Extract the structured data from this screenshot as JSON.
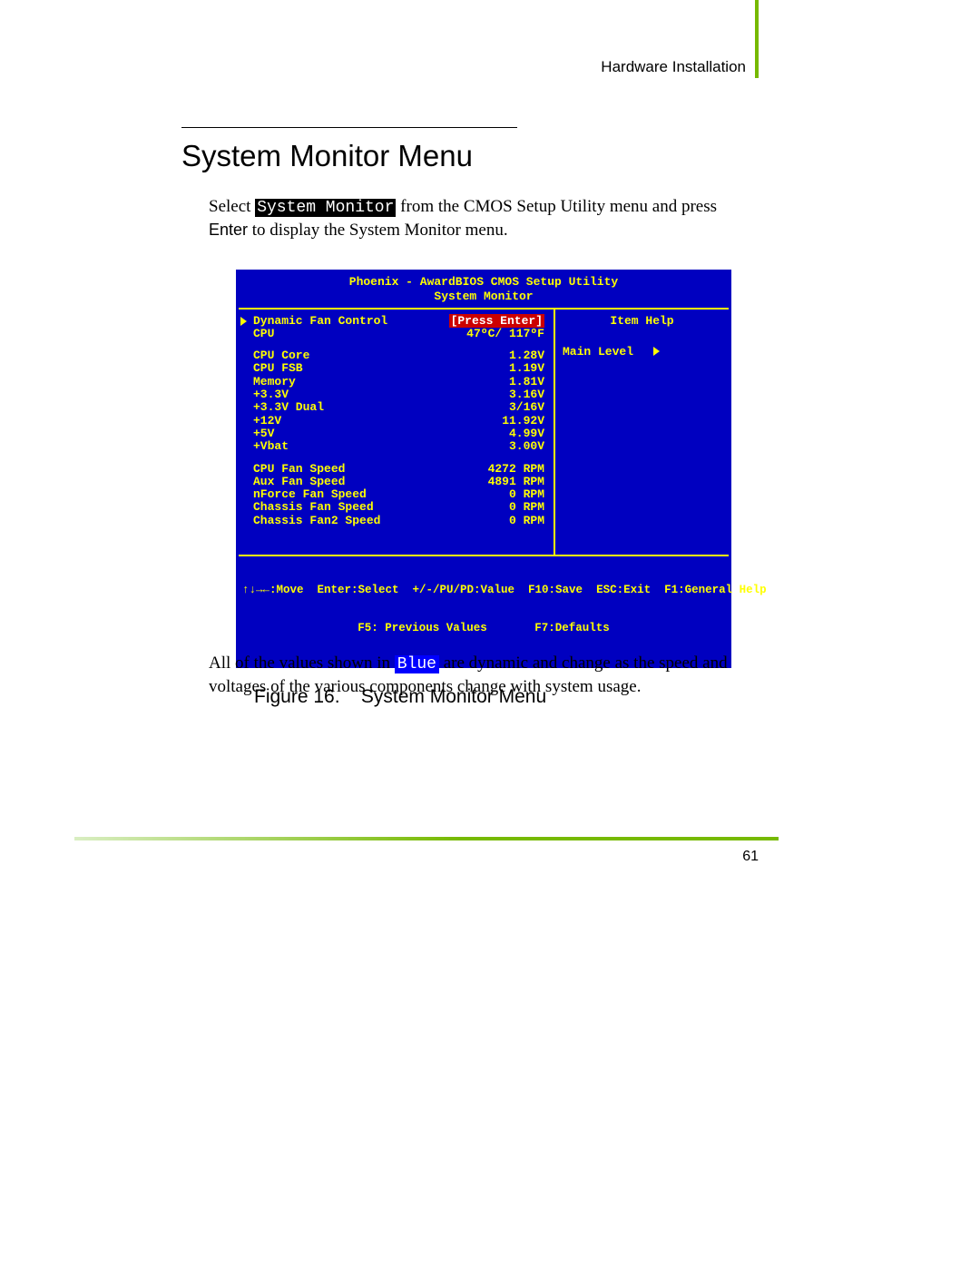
{
  "header": {
    "breadcrumb": "Hardware Installation"
  },
  "title": "System Monitor Menu",
  "intro": {
    "pre": "Select ",
    "box": "System Monitor",
    "mid": " from the CMOS Setup Utility menu and press ",
    "kbd": "Enter",
    "post": " to display the System Monitor menu."
  },
  "bios": {
    "title_line1": "Phoenix - AwardBIOS CMOS Setup Utility",
    "title_line2": "System Monitor",
    "help_title": "Item Help",
    "main_level": "Main Level",
    "first_row": {
      "label": "Dynamic Fan Control",
      "value": "[Press Enter]"
    },
    "rows_a": [
      {
        "label": "CPU",
        "value": "47ºC/ 117ºF"
      }
    ],
    "rows_b": [
      {
        "label": "CPU Core",
        "value": "1.28V"
      },
      {
        "label": "CPU FSB",
        "value": "1.19V"
      },
      {
        "label": "Memory",
        "value": "1.81V"
      },
      {
        "label": "+3.3V",
        "value": "3.16V"
      },
      {
        "label": "+3.3V Dual",
        "value": "3/16V"
      },
      {
        "label": "+12V",
        "value": "11.92V"
      },
      {
        "label": "+5V",
        "value": "4.99V"
      },
      {
        "label": "+Vbat",
        "value": "3.00V"
      }
    ],
    "rows_c": [
      {
        "label": "CPU Fan Speed",
        "value": "4272 RPM"
      },
      {
        "label": "Aux Fan Speed",
        "value": "4891 RPM"
      },
      {
        "label": "nForce Fan Speed",
        "value": "0 RPM"
      },
      {
        "label": "Chassis Fan Speed",
        "value": "0 RPM"
      },
      {
        "label": "Chassis Fan2 Speed",
        "value": "0 RPM"
      }
    ],
    "footer_line1": "↑↓→←:Move  Enter:Select  +/-/PU/PD:Value  F10:Save  ESC:Exit  F1:General Help",
    "footer_line2": "F5: Previous Values       F7:Defaults"
  },
  "figure_caption": "Figure 16.    System Monitor Menu",
  "note": {
    "pre": "All of the values shown in ",
    "box": "Blue",
    "post": " are dynamic and change as the speed and voltages of the various components change with system usage."
  },
  "page_number": "61"
}
